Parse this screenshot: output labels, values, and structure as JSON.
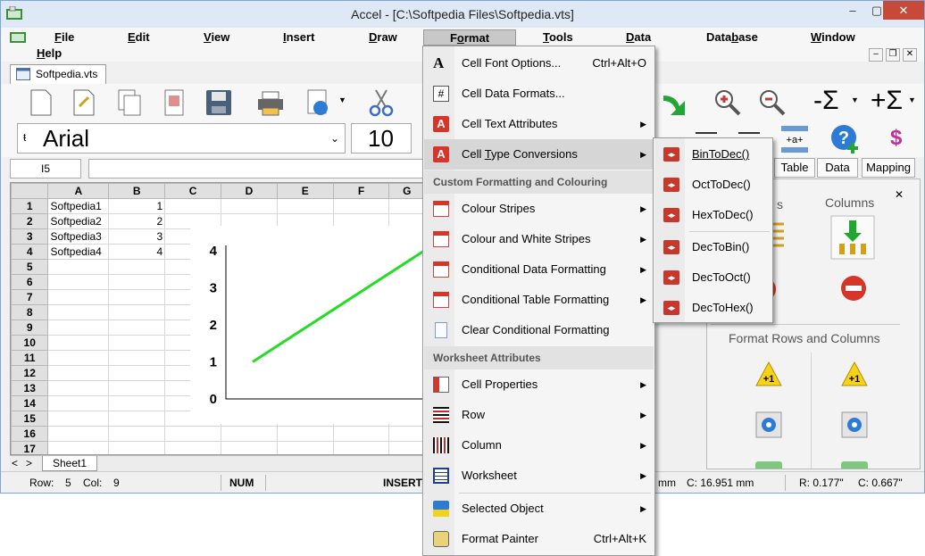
{
  "window": {
    "title": "Accel - [C:\\Softpedia Files\\Softpedia.vts]",
    "minimize": "–",
    "maximize": "▢",
    "close": "✕"
  },
  "menubar": [
    {
      "pre": "",
      "u": "F",
      "post": "ile"
    },
    {
      "pre": "",
      "u": "E",
      "post": "dit"
    },
    {
      "pre": "",
      "u": "V",
      "post": "iew"
    },
    {
      "pre": "",
      "u": "I",
      "post": "nsert"
    },
    {
      "pre": "",
      "u": "D",
      "post": "raw"
    },
    {
      "pre": "F",
      "u": "o",
      "post": "rmat"
    },
    {
      "pre": "",
      "u": "T",
      "post": "ools"
    },
    {
      "pre": "",
      "u": "D",
      "post": "ata"
    },
    {
      "pre": "Data",
      "u": "b",
      "post": "ase"
    },
    {
      "pre": "",
      "u": "W",
      "post": "indow"
    },
    {
      "pre": "",
      "u": "H",
      "post": "elp"
    }
  ],
  "document_tab": "Softpedia.vts",
  "toolbar": {
    "font": "Arial",
    "font_size": "10"
  },
  "formula_bar": {
    "cell_ref": "I5",
    "value": ""
  },
  "grid": {
    "columns": [
      "A",
      "B",
      "C",
      "D",
      "E",
      "F",
      "G"
    ],
    "rows": [
      {
        "n": "1",
        "a": "Softpedia1",
        "b": "1"
      },
      {
        "n": "2",
        "a": "Softpedia2",
        "b": "2"
      },
      {
        "n": "3",
        "a": "Softpedia3",
        "b": "3"
      },
      {
        "n": "4",
        "a": "Softpedia4",
        "b": "4"
      },
      {
        "n": "5",
        "a": "",
        "b": ""
      },
      {
        "n": "6",
        "a": "",
        "b": ""
      },
      {
        "n": "7",
        "a": "",
        "b": ""
      },
      {
        "n": "8",
        "a": "",
        "b": ""
      },
      {
        "n": "9",
        "a": "",
        "b": ""
      },
      {
        "n": "10",
        "a": "",
        "b": ""
      },
      {
        "n": "11",
        "a": "",
        "b": ""
      },
      {
        "n": "12",
        "a": "",
        "b": ""
      },
      {
        "n": "13",
        "a": "",
        "b": ""
      },
      {
        "n": "14",
        "a": "",
        "b": ""
      },
      {
        "n": "15",
        "a": "",
        "b": ""
      },
      {
        "n": "16",
        "a": "",
        "b": ""
      },
      {
        "n": "17",
        "a": "",
        "b": ""
      }
    ]
  },
  "chart": {
    "y_ticks": [
      "4",
      "3",
      "2",
      "1",
      "0"
    ],
    "line_color": "#22dd22",
    "x": [
      1,
      2,
      3,
      4
    ],
    "y": [
      1,
      2,
      3,
      4
    ],
    "ylim": [
      0,
      4
    ]
  },
  "sheet_tabs": {
    "nav_left": "<",
    "nav_right": ">",
    "active": "Sheet1"
  },
  "statusbar": {
    "row_label": "Row:",
    "row": "5",
    "col_label": "Col:",
    "col": "9",
    "num": "NUM",
    "insert": "INSERT",
    "mm_fragment": "mm",
    "c_mm": "C: 16.951 mm",
    "r_in": "R: 0.177\"",
    "c_in": "C: 0.667\""
  },
  "right_panel": {
    "tabs": [
      "Table",
      "Data",
      "Mapping"
    ],
    "columns_label": "Columns",
    "rows_label_fragment": "s",
    "format_label": "Format Rows and Columns",
    "badge": "+1",
    "close": "✕"
  },
  "format_menu": {
    "items": [
      {
        "pre": "Cell Font Options...",
        "u": "",
        "post": "",
        "shortcut": "Ctrl+Alt+O",
        "icon": "font-options-icon",
        "submenu": false
      },
      {
        "pre": "Cell Data Formats...",
        "u": "",
        "post": "",
        "shortcut": "",
        "icon": "data-formats-icon",
        "submenu": false
      },
      {
        "pre": "Cell Text Attributes",
        "u": "",
        "post": "",
        "shortcut": "",
        "icon": "text-attributes-icon",
        "submenu": true
      },
      {
        "pre": "Cell ",
        "u": "T",
        "post": "ype Conversions",
        "shortcut": "",
        "icon": "type-conversions-icon",
        "submenu": true
      }
    ],
    "header_custom": "Custom Formatting and Colouring",
    "items_custom": [
      {
        "label": "Colour Stripes",
        "submenu": true
      },
      {
        "label": "Colour and White Stripes",
        "submenu": true
      },
      {
        "label": "Conditional Data Formatting",
        "submenu": true
      },
      {
        "label": "Conditional Table Formatting",
        "submenu": true
      },
      {
        "label": "Clear Conditional Formatting",
        "submenu": false
      }
    ],
    "header_worksheet": "Worksheet Attributes",
    "items_worksheet": [
      {
        "label": "Cell Properties",
        "submenu": true
      },
      {
        "label": "Row",
        "submenu": true
      },
      {
        "label": "Column",
        "submenu": true
      },
      {
        "label": "Worksheet",
        "submenu": true
      }
    ],
    "items_bottom": [
      {
        "label": "Selected Object",
        "shortcut": "",
        "submenu": true
      },
      {
        "label": "Format Painter",
        "shortcut": "Ctrl+Alt+K",
        "submenu": false
      }
    ]
  },
  "conversions_submenu": [
    "BinToDec()",
    "OctToDec()",
    "HexToDec()",
    "DecToBin()",
    "DecToOct()",
    "DecToHex()"
  ],
  "colors": {
    "accent": "#1f6fd0",
    "menu_selected": "#d6d6d6",
    "close_button": "#c7493a"
  }
}
